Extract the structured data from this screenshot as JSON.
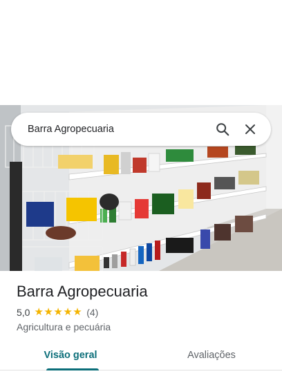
{
  "search": {
    "query": "Barra Agropecuaria",
    "search_icon": "search-icon",
    "clear_icon": "close-icon"
  },
  "photo": {
    "subject": "store-interior-photo"
  },
  "place": {
    "name": "Barra Agropecuaria",
    "rating": "5,0",
    "stars": 5,
    "review_count": "(4)",
    "category": "Agricultura e pecuária"
  },
  "tabs": [
    {
      "label": "Visão geral",
      "active": true
    },
    {
      "label": "Avaliações",
      "active": false
    }
  ],
  "colors": {
    "accent": "#0b6e79",
    "star": "#f4b400",
    "secondary_text": "#5f6368"
  }
}
